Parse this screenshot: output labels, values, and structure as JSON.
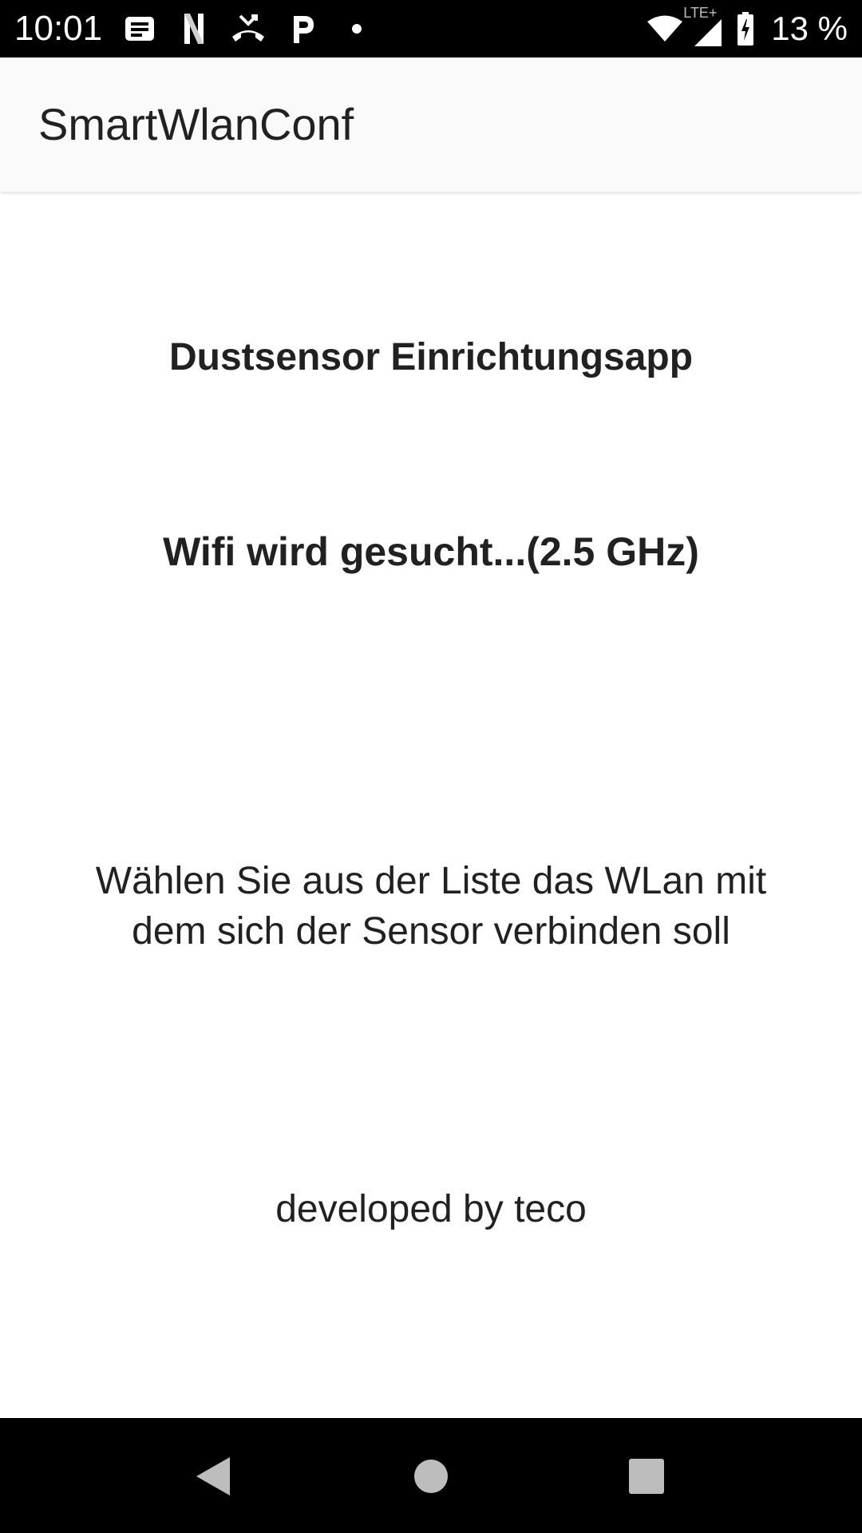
{
  "status_bar": {
    "time": "10:01",
    "battery_text": "13 %",
    "network_type": "LTE+",
    "left_icons": [
      "message-icon",
      "netflix-icon",
      "missed-call-icon",
      "parking-icon",
      "dot-icon"
    ],
    "right_icons": [
      "wifi-icon",
      "cell-signal-icon",
      "battery-charging-icon"
    ]
  },
  "app_bar": {
    "title": "SmartWlanConf"
  },
  "main": {
    "heading": "Dustsensor Einrichtungsapp",
    "wifi_status": "Wifi wird gesucht...(2.5 GHz)",
    "instruction": "Wählen Sie aus der Liste das WLan mit dem sich der Sensor verbinden soll",
    "credit": "developed by teco"
  },
  "nav_bar": {
    "buttons": [
      "back-icon",
      "home-icon",
      "recents-icon"
    ]
  },
  "colors": {
    "status_bar_bg": "#000000",
    "app_bar_bg": "#fafafa",
    "text_primary": "#212121",
    "nav_icon": "#bdbdbd"
  }
}
